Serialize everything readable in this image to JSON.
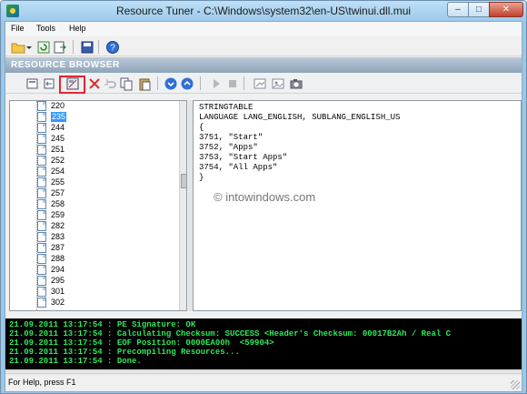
{
  "window": {
    "title": "Resource Tuner - C:\\Windows\\system32\\en-US\\twinui.dll.mui",
    "controls": [
      "minimize",
      "maximize",
      "close"
    ]
  },
  "menu": {
    "file": "File",
    "tools": "Tools",
    "help": "Help"
  },
  "toolbar1_icons": [
    "open-icon",
    "dropdown-arrow-icon",
    "refresh-icon",
    "export-icon",
    "save-icon",
    "help-icon"
  ],
  "resource_browser": {
    "title": "RESOURCE BROWSER"
  },
  "toolbar2_icons": [
    "resource-icon",
    "back-icon",
    "edit-resource-icon",
    "delete-icon",
    "undo-icon",
    "copy-icon",
    "paste-icon",
    "down-arrow-icon",
    "up-arrow-icon",
    "play-icon",
    "stop-icon",
    "dialog-icon",
    "image-icon",
    "camera-icon"
  ],
  "tree": {
    "items": [
      "220",
      "235",
      "244",
      "245",
      "251",
      "252",
      "254",
      "255",
      "257",
      "258",
      "259",
      "282",
      "283",
      "287",
      "288",
      "294",
      "295",
      "301",
      "302"
    ],
    "selected": "235"
  },
  "resource_text": {
    "lines": [
      "STRINGTABLE",
      "LANGUAGE LANG_ENGLISH, SUBLANG_ENGLISH_US",
      "{",
      "3751, \"Start\"",
      "3752, \"Apps\"",
      "3753, \"Start Apps\"",
      "3754, \"All Apps\"",
      "}"
    ]
  },
  "watermark": "© intowindows.com",
  "log": {
    "lines": [
      "21.09.2011 13:17:54 : PE Signature: OK",
      "21.09.2011 13:17:54 : Calculating Checksum: SUCCESS <Header's Checksum: 00017B2Ah / Real C",
      "21.09.2011 13:17:54 : EOF Position: 0000EA00h  <59904>",
      "21.09.2011 13:17:54 : Precompiling Resources...",
      "21.09.2011 13:17:54 : Done."
    ],
    "color": "#2ee85a"
  },
  "status": {
    "text": "For Help, press F1"
  },
  "colors": {
    "highlight_box": "#e2262c",
    "selection": "#3399ff",
    "log_background": "#000000"
  }
}
